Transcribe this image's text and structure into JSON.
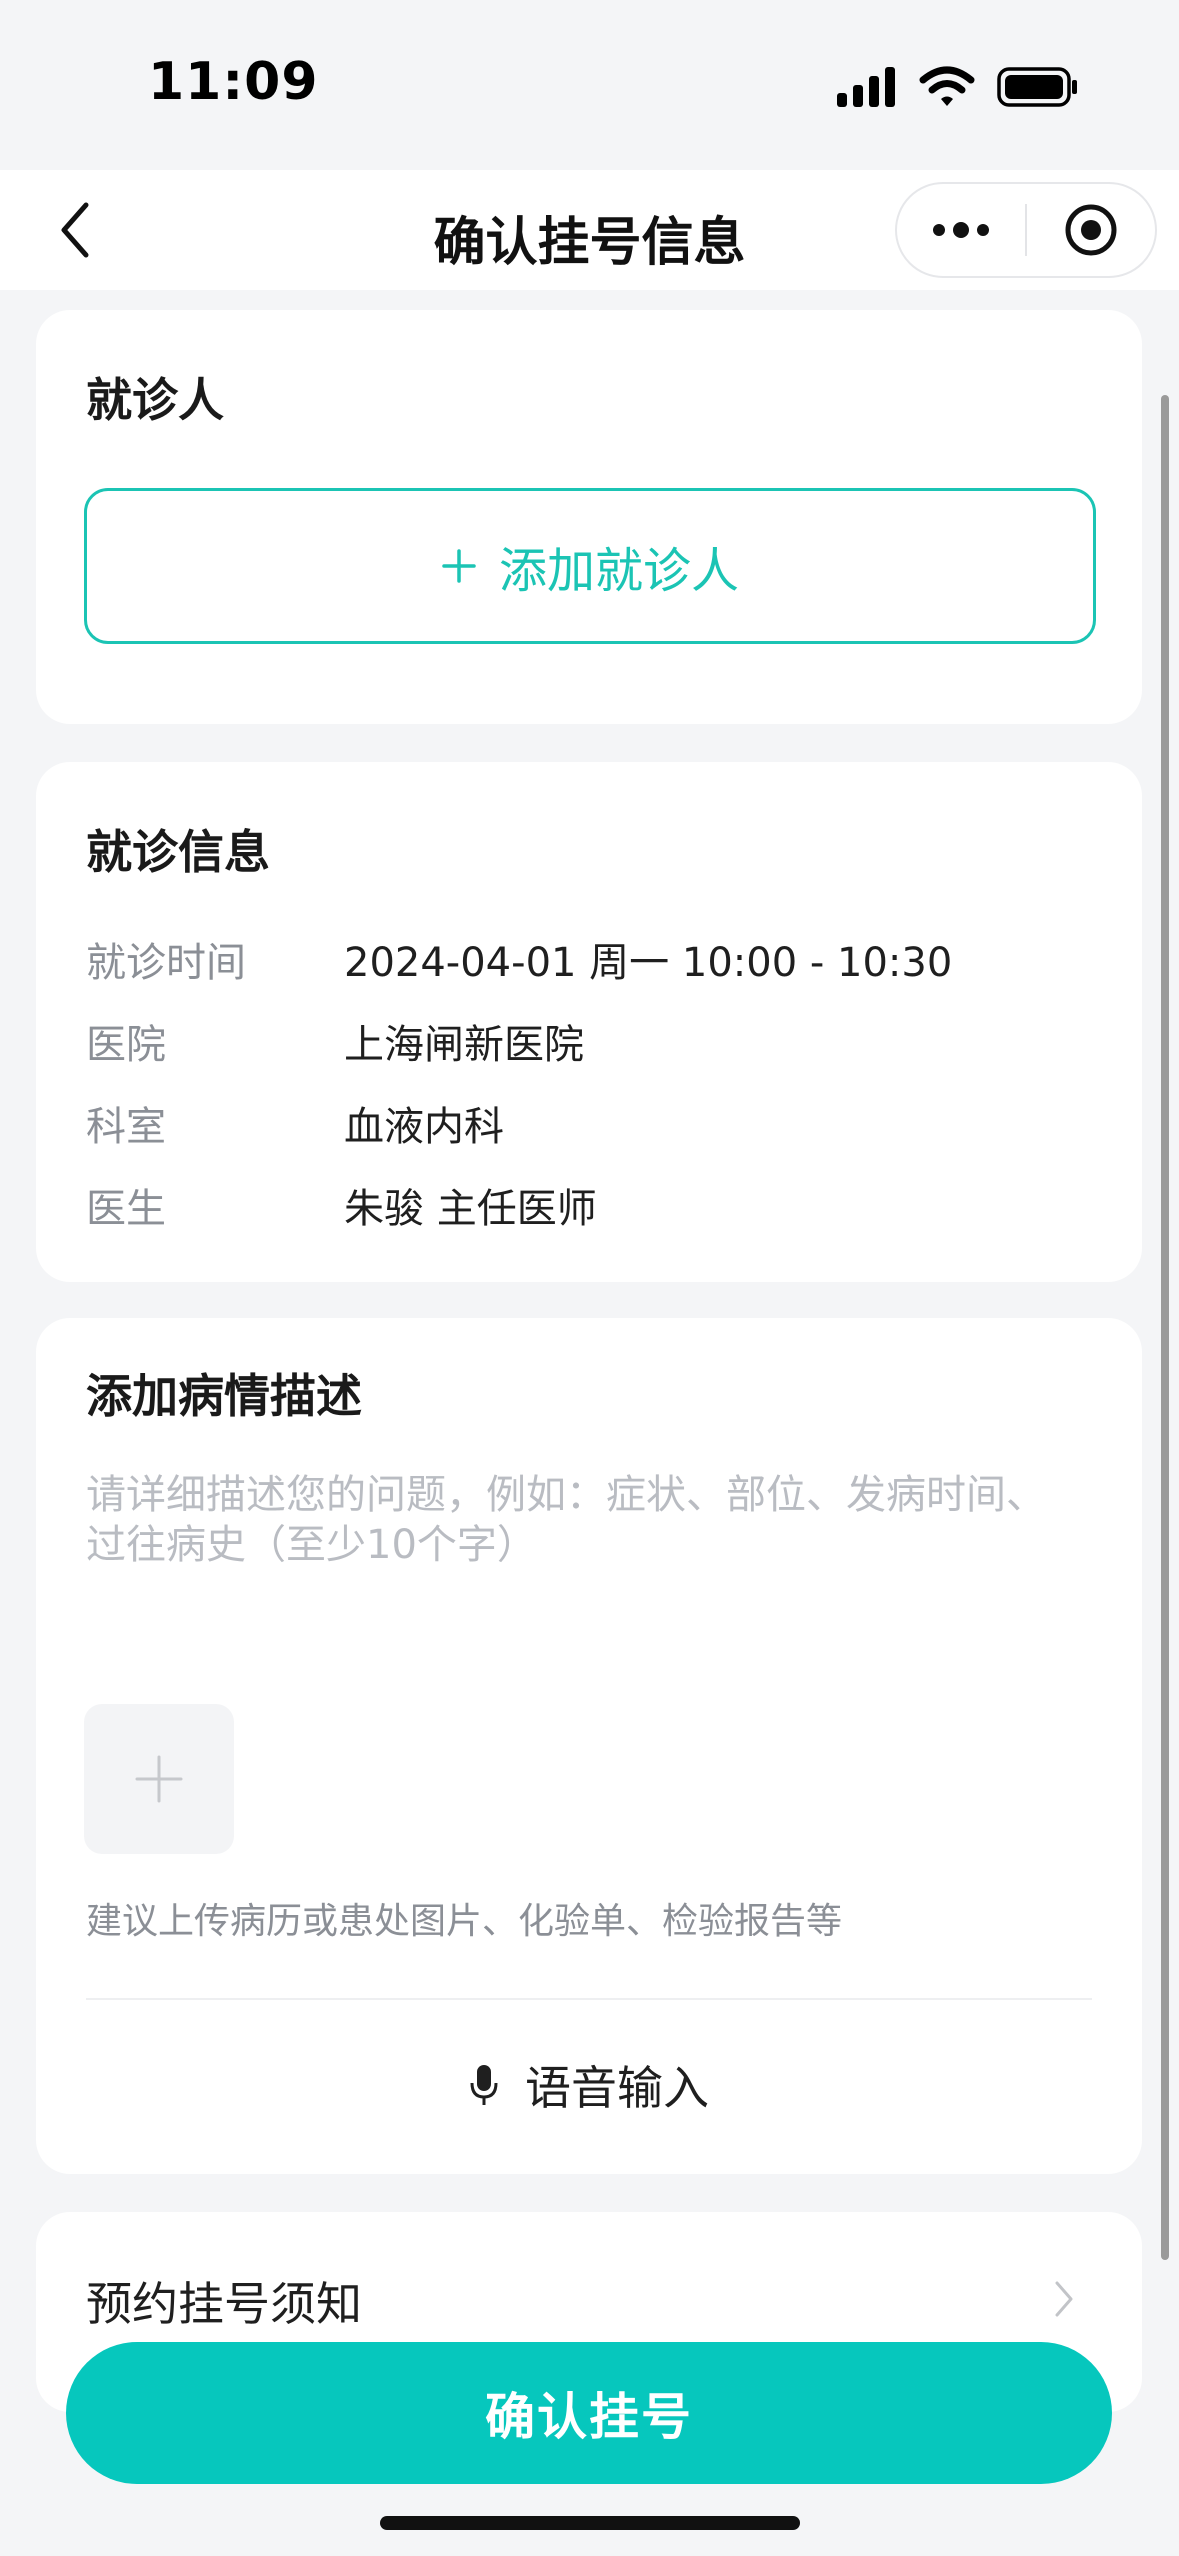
{
  "status_bar": {
    "time": "11:09"
  },
  "nav": {
    "title": "确认挂号信息",
    "back_icon": "chevron-left-icon",
    "more_icon": "more-dots-icon",
    "close_icon": "target-circle-icon"
  },
  "patient": {
    "title": "就诊人",
    "add_label": "添加就诊人",
    "add_icon": "plus-icon"
  },
  "visit": {
    "title": "就诊信息",
    "rows": [
      {
        "label": "就诊时间",
        "value": "2024-04-01 周一 10:00 - 10:30"
      },
      {
        "label": "医院",
        "value": "上海闸新医院"
      },
      {
        "label": "科室",
        "value": "血液内科"
      },
      {
        "label": "医生",
        "value": "朱骏 主任医师"
      }
    ]
  },
  "description": {
    "title": "添加病情描述",
    "placeholder": "请详细描述您的问题，例如：症状、部位、发病时间、过往病史（至少10个字）",
    "upload_icon": "plus-icon",
    "upload_hint": "建议上传病历或患处图片、化验单、检验报告等",
    "voice_label": "语音输入",
    "voice_icon": "microphone-icon"
  },
  "notice": {
    "label": "预约挂号须知",
    "chevron_icon": "chevron-right-icon"
  },
  "confirm": {
    "label": "确认挂号"
  },
  "colors": {
    "accent": "#06c7bd",
    "accent_outline": "#1bc4b4",
    "background": "#f4f5f7",
    "muted_text": "#8b8f96"
  }
}
